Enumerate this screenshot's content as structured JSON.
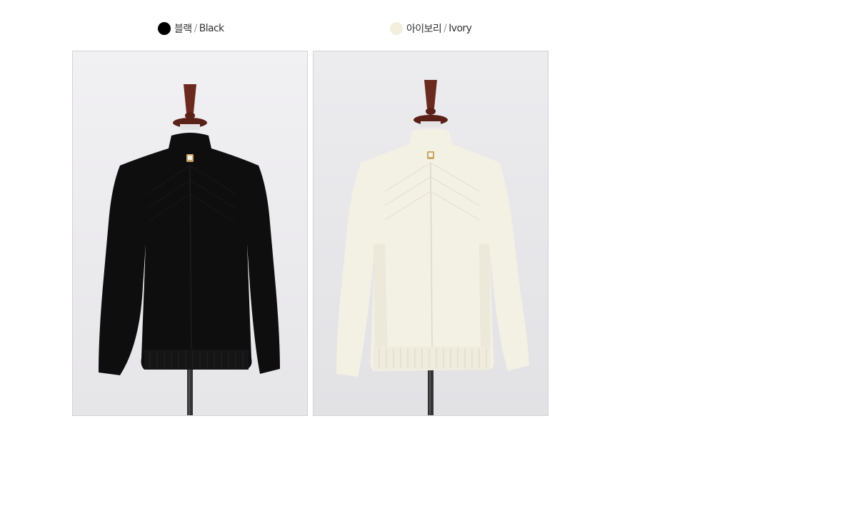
{
  "colors": [
    {
      "name_ko": "블랙",
      "separator": "/",
      "name_en": "Black",
      "swatch": "#000000",
      "garment": "#0e0e0e",
      "photo_alt": "Black mock-neck knit sweater on mannequin"
    },
    {
      "name_ko": "아이보리",
      "separator": "/",
      "name_en": "Ivory",
      "swatch": "#f4eedf",
      "garment": "#f3f0e4",
      "photo_alt": "Ivory mock-neck knit sweater on mannequin"
    }
  ],
  "backdrop": "#ececef",
  "mannequin": {
    "wood": "#6b2a1f",
    "stand": "#333333"
  }
}
